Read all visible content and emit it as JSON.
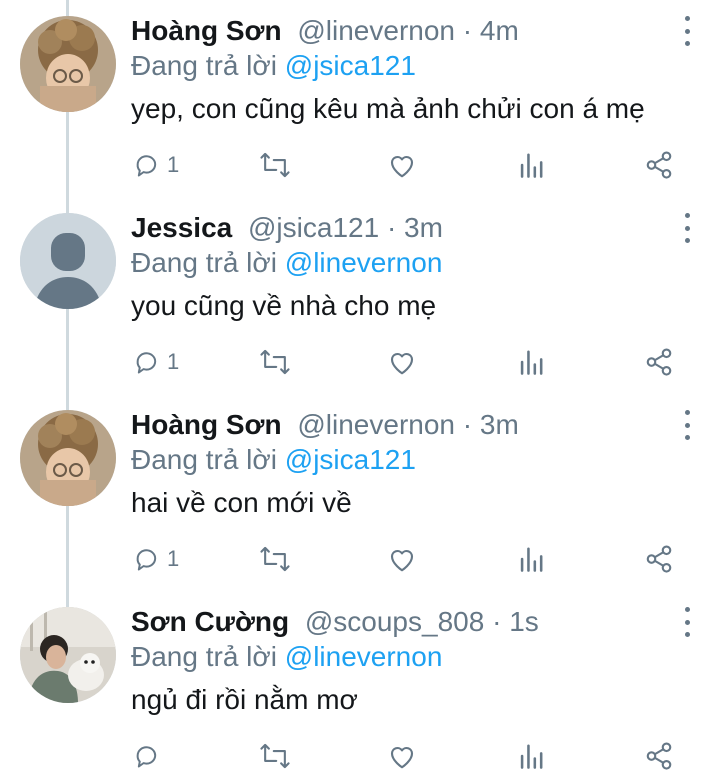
{
  "colors": {
    "text": "#14171a",
    "muted": "#657786",
    "link": "#1da1f2",
    "thread_line": "#cfd9de"
  },
  "reply_prefix": "Đang trả lời",
  "tweets": [
    {
      "name": "Hoàng Sơn",
      "handle": "@linevernon",
      "separator": "·",
      "time": "4m",
      "reply_to": "@jsica121",
      "text": "yep, con cũng kêu mà ảnh chửi con á mẹ",
      "reply_count": "1",
      "avatar": "photo-avatar-curly-hair"
    },
    {
      "name": "Jessica",
      "handle": "@jsica121",
      "separator": "·",
      "time": "3m",
      "reply_to": "@linevernon",
      "text": "you cũng về nhà cho mẹ",
      "reply_count": "1",
      "avatar": "default-avatar"
    },
    {
      "name": "Hoàng Sơn",
      "handle": "@linevernon",
      "separator": "·",
      "time": "3m",
      "reply_to": "@jsica121",
      "text": "hai về con mới về",
      "reply_count": "1",
      "avatar": "photo-avatar-curly-hair"
    },
    {
      "name": "Sơn Cường",
      "handle": "@scoups_808",
      "separator": "·",
      "time": "1s",
      "reply_to": "@linevernon",
      "text": "ngủ đi rồi nằm mơ",
      "reply_count": "",
      "avatar": "photo-avatar-man-with-dog"
    }
  ],
  "icons": [
    "reply-icon",
    "retweet-icon",
    "like-icon",
    "analytics-icon",
    "share-icon",
    "more-options-icon"
  ]
}
